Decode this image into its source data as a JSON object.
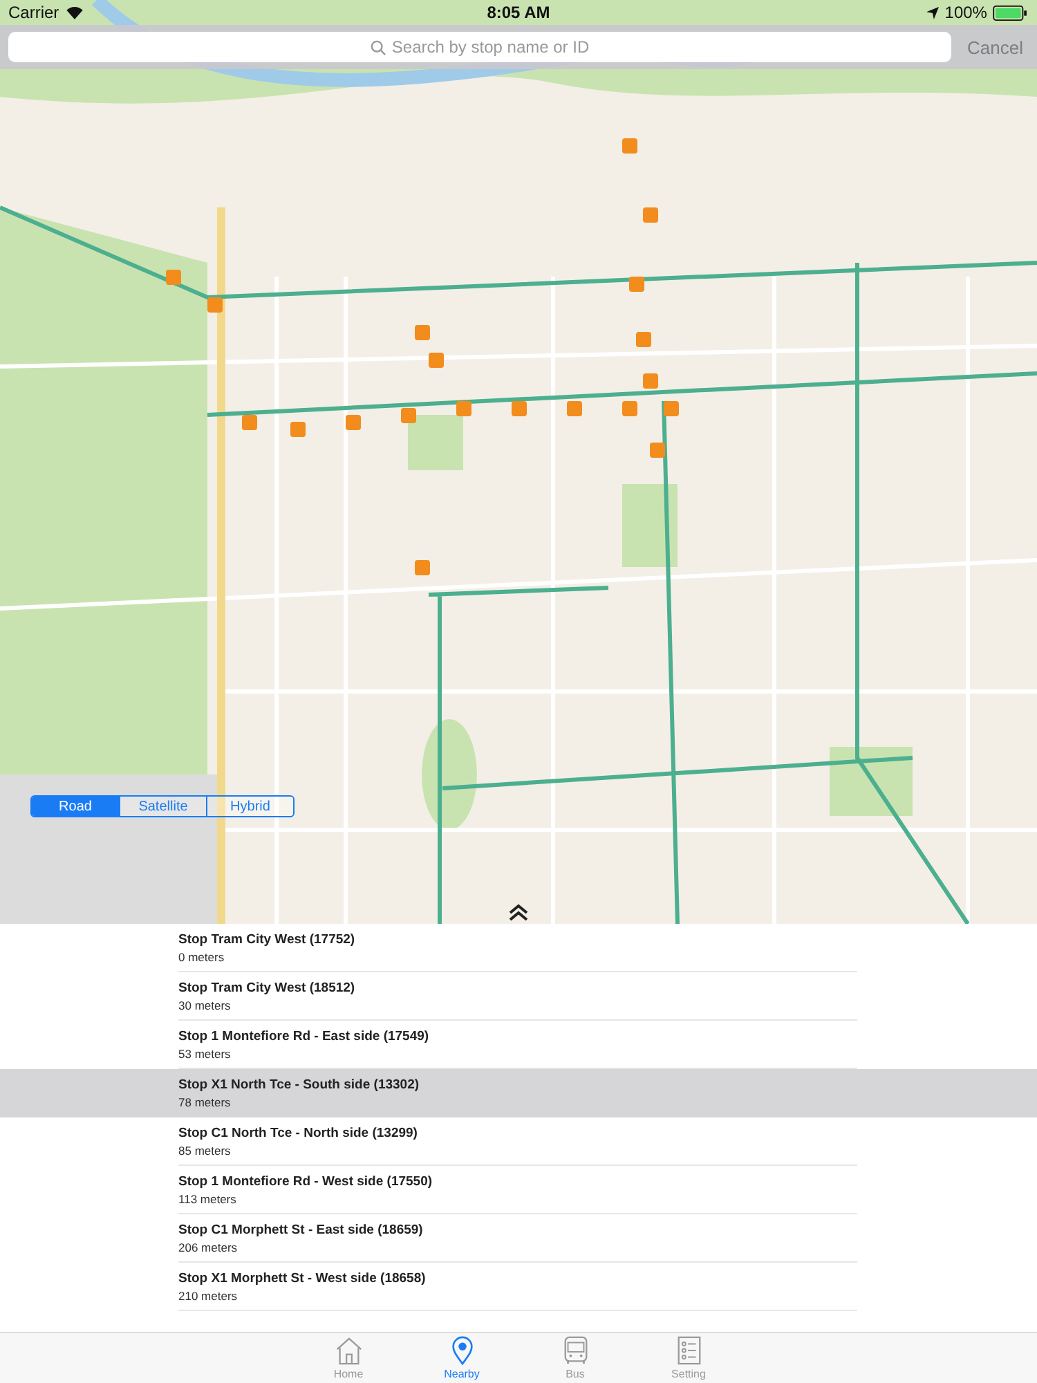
{
  "status_bar": {
    "carrier": "Carrier",
    "time": "8:05 AM",
    "battery": "100%"
  },
  "search": {
    "placeholder": "Search by stop name or ID",
    "cancel": "Cancel"
  },
  "map_types": [
    {
      "label": "Road",
      "selected": true
    },
    {
      "label": "Satellite",
      "selected": false
    },
    {
      "label": "Hybrid",
      "selected": false
    }
  ],
  "stops": [
    {
      "name": "Stop Tram City West (17752)",
      "distance": "0 meters",
      "selected": false
    },
    {
      "name": "Stop Tram City West (18512)",
      "distance": "30 meters",
      "selected": false
    },
    {
      "name": "Stop 1 Montefiore Rd - East side (17549)",
      "distance": "53 meters",
      "selected": false
    },
    {
      "name": "Stop X1 North Tce - South side (13302)",
      "distance": "78 meters",
      "selected": true
    },
    {
      "name": "Stop C1 North Tce - North side (13299)",
      "distance": "85 meters",
      "selected": false
    },
    {
      "name": "Stop 1 Montefiore Rd - West side (17550)",
      "distance": "113 meters",
      "selected": false
    },
    {
      "name": "Stop C1 Morphett St - East side (18659)",
      "distance": "206 meters",
      "selected": false
    },
    {
      "name": "Stop X1 Morphett St - West side (18658)",
      "distance": "210 meters",
      "selected": false
    }
  ],
  "tabs": [
    {
      "kind": "home",
      "label": "Home",
      "selected": false
    },
    {
      "kind": "nearby",
      "label": "Nearby",
      "selected": true
    },
    {
      "kind": "bus",
      "label": "Bus",
      "selected": false
    },
    {
      "kind": "setting",
      "label": "Setting",
      "selected": false
    }
  ]
}
